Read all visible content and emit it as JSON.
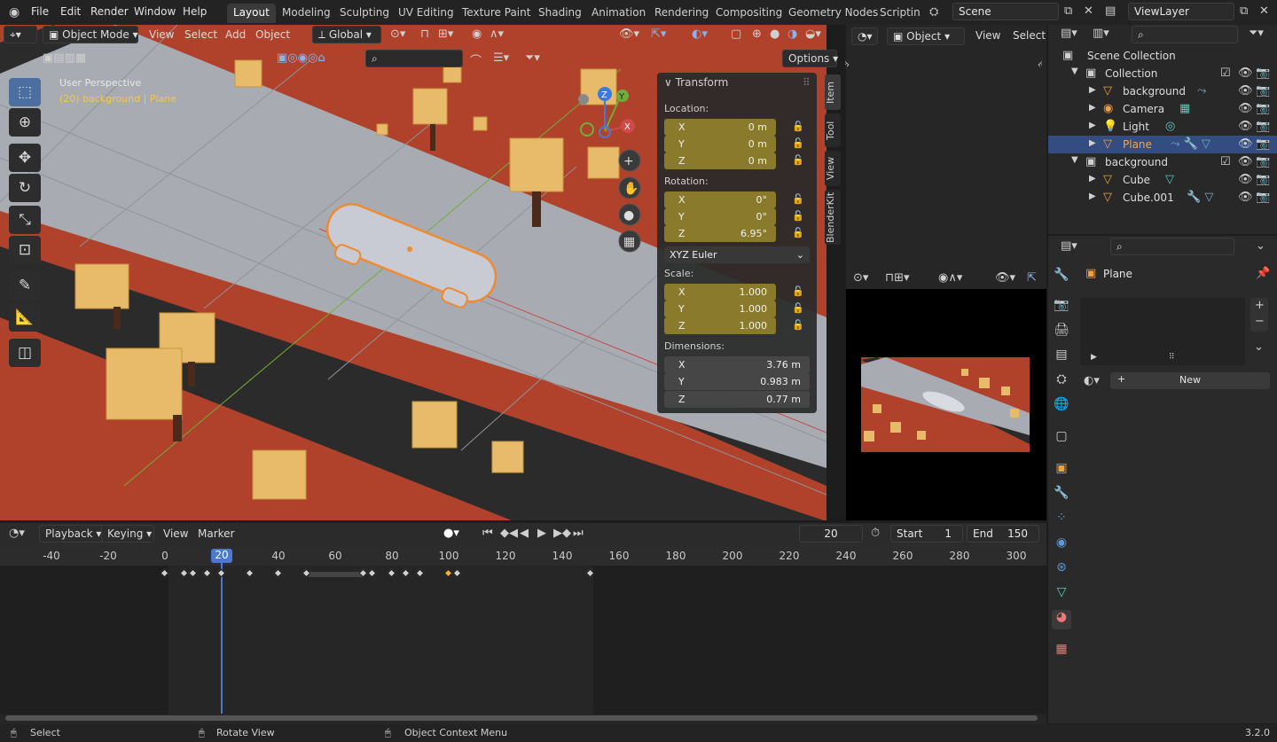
{
  "topbar": {
    "menus": [
      "File",
      "Edit",
      "Render",
      "Window",
      "Help"
    ],
    "workspaces": [
      "Layout",
      "Modeling",
      "Sculpting",
      "UV Editing",
      "Texture Paint",
      "Shading",
      "Animation",
      "Rendering",
      "Compositing",
      "Geometry Nodes",
      "Scripting"
    ],
    "scene": "Scene",
    "view_layer": "ViewLayer"
  },
  "viewport": {
    "mode": "Object Mode",
    "menus": [
      "View",
      "Select",
      "Add",
      "Object"
    ],
    "orientation": "Global",
    "options": "Options",
    "perspective": "User Perspective",
    "object_info": "(20) background | Plane",
    "tabs": [
      "Item",
      "Tool",
      "View",
      "BlenderKit"
    ]
  },
  "transform": {
    "title": "Transform",
    "location_label": "Location:",
    "location": [
      {
        "axis": "X",
        "value": "0 m"
      },
      {
        "axis": "Y",
        "value": "0 m"
      },
      {
        "axis": "Z",
        "value": "0 m"
      }
    ],
    "rotation_label": "Rotation:",
    "rotation": [
      {
        "axis": "X",
        "value": "0°"
      },
      {
        "axis": "Y",
        "value": "0°"
      },
      {
        "axis": "Z",
        "value": "6.95°"
      }
    ],
    "rotation_mode": "XYZ Euler",
    "scale_label": "Scale:",
    "scale": [
      {
        "axis": "X",
        "value": "1.000"
      },
      {
        "axis": "Y",
        "value": "1.000"
      },
      {
        "axis": "Z",
        "value": "1.000"
      }
    ],
    "dimensions_label": "Dimensions:",
    "dimensions": [
      {
        "axis": "X",
        "value": "3.76 m"
      },
      {
        "axis": "Y",
        "value": "0.983 m"
      },
      {
        "axis": "Z",
        "value": "0.77 m"
      }
    ]
  },
  "camera_view": {
    "mode": "Object",
    "menus": [
      "View",
      "Select"
    ]
  },
  "outliner": {
    "root": "Scene Collection",
    "rows": [
      {
        "name": "Collection",
        "indent": 1
      },
      {
        "name": "background",
        "indent": 2
      },
      {
        "name": "Camera",
        "indent": 2
      },
      {
        "name": "Light",
        "indent": 2
      },
      {
        "name": "Plane",
        "indent": 2
      },
      {
        "name": "background",
        "indent": 1
      },
      {
        "name": "Cube",
        "indent": 2
      },
      {
        "name": "Cube.001",
        "indent": 2
      }
    ]
  },
  "properties": {
    "object_name": "Plane",
    "new_button": "New"
  },
  "timeline": {
    "menus": [
      "Playback",
      "Keying",
      "View",
      "Marker"
    ],
    "current_frame": "20",
    "start_label": "Start",
    "start": "1",
    "end_label": "End",
    "end": "150",
    "ruler": [
      "-40",
      "-20",
      "0",
      "20",
      "40",
      "60",
      "80",
      "100",
      "120",
      "140",
      "160",
      "180",
      "200",
      "220",
      "240",
      "260",
      "280",
      "300"
    ],
    "keyframes": [
      0,
      7,
      10,
      15,
      20,
      30,
      40,
      50,
      70,
      73,
      80,
      85,
      90,
      100,
      103,
      150
    ],
    "selected_keyframe": 100
  },
  "status": {
    "select": "Select",
    "rotate": "Rotate View",
    "context": "Object Context Menu",
    "version": "3.2.0"
  },
  "colors": {
    "accent": "#4a6fa0",
    "keyframe": "#d0d0d0",
    "keyframe_selected": "#f0b030",
    "field_gold": "#8a7a2b",
    "ground": "#b0412a"
  }
}
